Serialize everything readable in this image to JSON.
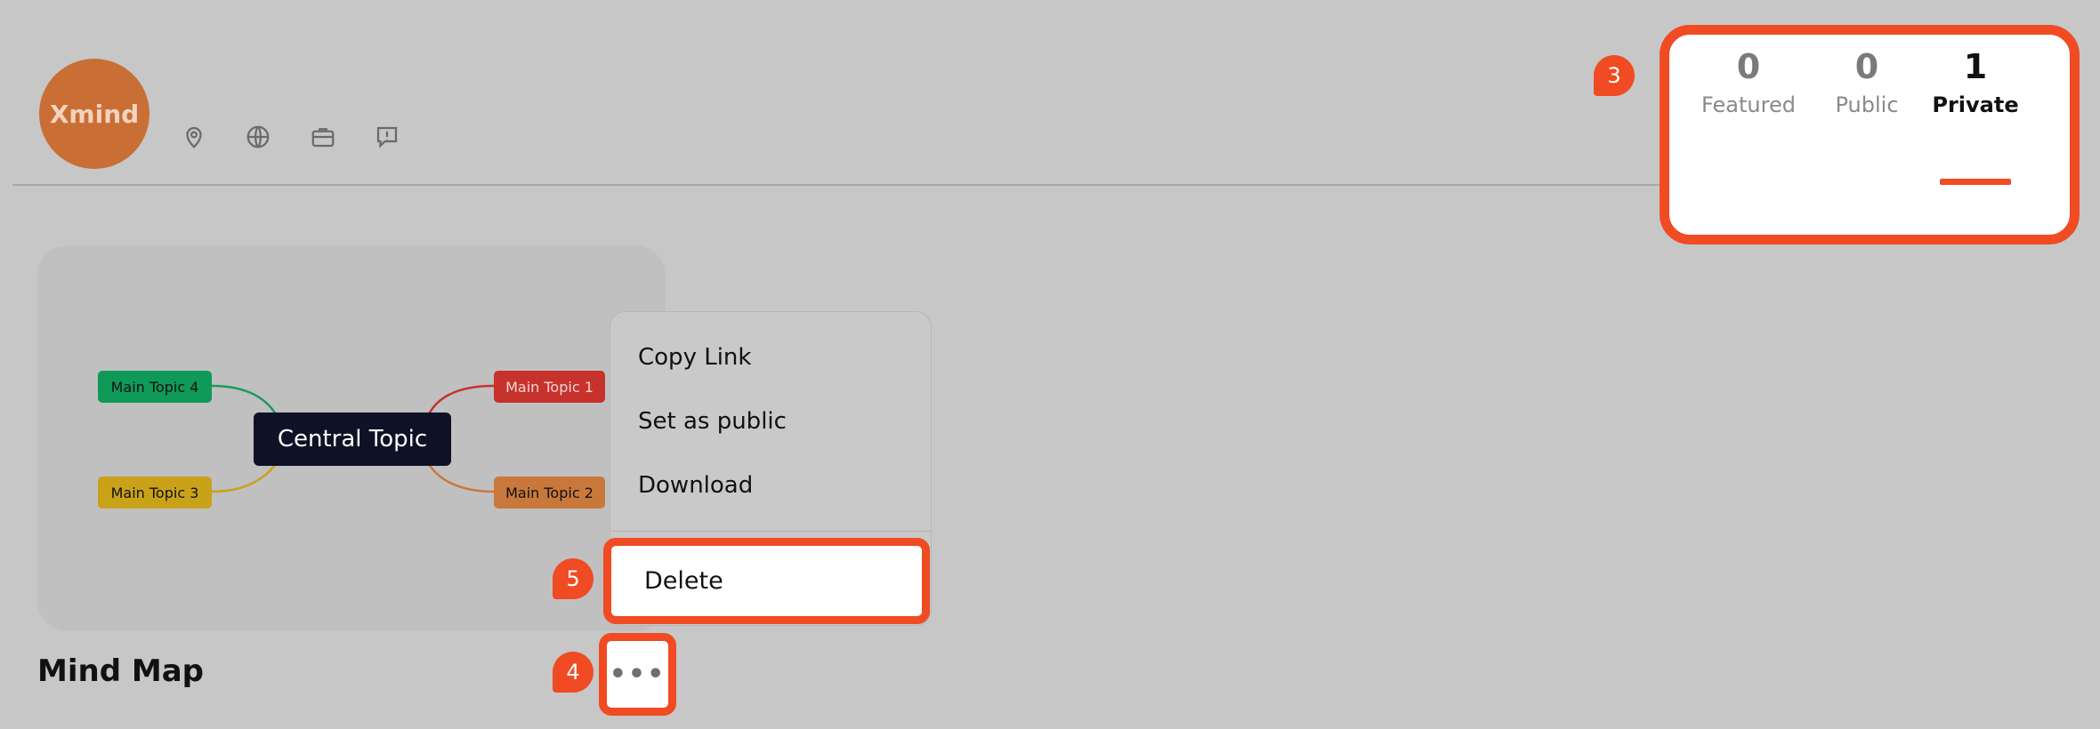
{
  "profile": {
    "avatar_text": "Xmind"
  },
  "header_icons": [
    "location-pin-icon",
    "globe-icon",
    "briefcase-icon",
    "feedback-icon"
  ],
  "stats": [
    {
      "count": "0",
      "label": "Featured"
    },
    {
      "count": "0",
      "label": "Public"
    },
    {
      "count": "1",
      "label": "Private",
      "active": true
    }
  ],
  "markers": {
    "stats": "3",
    "more": "4",
    "delete": "5"
  },
  "card": {
    "title": "Mind Map",
    "central_topic": "Central Topic",
    "topics": [
      {
        "label": "Main Topic 4",
        "color": "#0f9a5a"
      },
      {
        "label": "Main Topic 3",
        "color": "#c9a21a"
      },
      {
        "label": "Main Topic 1",
        "color": "#c7322c"
      },
      {
        "label": "Main Topic 2",
        "color": "#c9783b"
      }
    ]
  },
  "menu": {
    "items": [
      "Copy Link",
      "Set as public",
      "Download"
    ],
    "delete_label": "Delete"
  },
  "more_button": {
    "label": "•••"
  },
  "accent_color": "#f04b23"
}
